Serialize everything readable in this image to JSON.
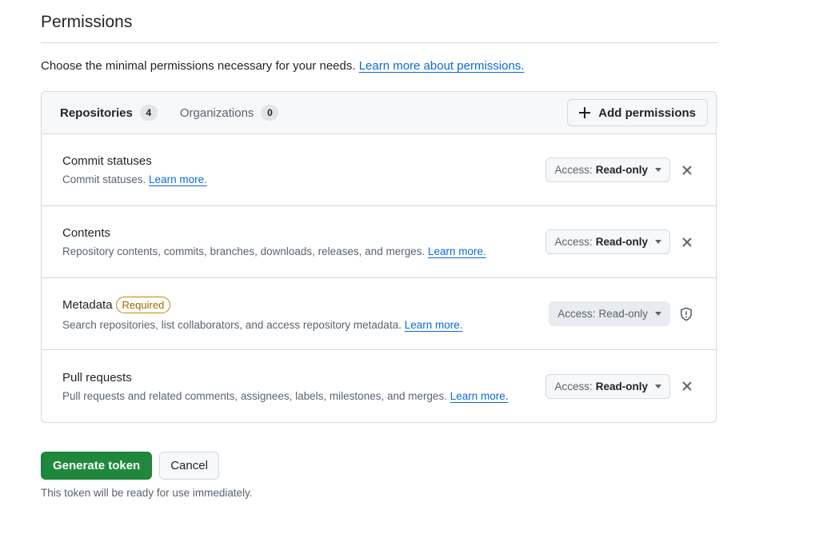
{
  "section": {
    "title": "Permissions",
    "intro": "Choose the minimal permissions necessary for your needs.",
    "intro_link": "Learn more about permissions."
  },
  "tabs": [
    {
      "label": "Repositories",
      "count": "4"
    },
    {
      "label": "Organizations",
      "count": "0"
    }
  ],
  "add_permissions_label": "Add permissions",
  "permissions": [
    {
      "title": "Commit statuses",
      "description": "Commit statuses.",
      "link": "Learn more.",
      "access_key": "Access:",
      "access_value": "Read-only"
    },
    {
      "title": "Contents",
      "description": "Repository contents, commits, branches, downloads, releases, and merges.",
      "link": "Learn more.",
      "access_key": "Access:",
      "access_value": "Read-only"
    },
    {
      "title": "Metadata",
      "badge": "Required",
      "description": "Search repositories, list collaborators, and access repository metadata.",
      "link": "Learn more.",
      "access_key": "Access:",
      "access_value": "Read-only"
    },
    {
      "title": "Pull requests",
      "description": "Pull requests and related comments, assignees, labels, milestones, and merges.",
      "link": "Learn more.",
      "access_key": "Access:",
      "access_value": "Read-only"
    }
  ],
  "actions": {
    "generate_label": "Generate token",
    "cancel_label": "Cancel",
    "note": "This token will be ready for use immediately."
  },
  "colors": {
    "primary": "#1f883d",
    "link": "#0969da",
    "required_badge": "#9a6700"
  }
}
